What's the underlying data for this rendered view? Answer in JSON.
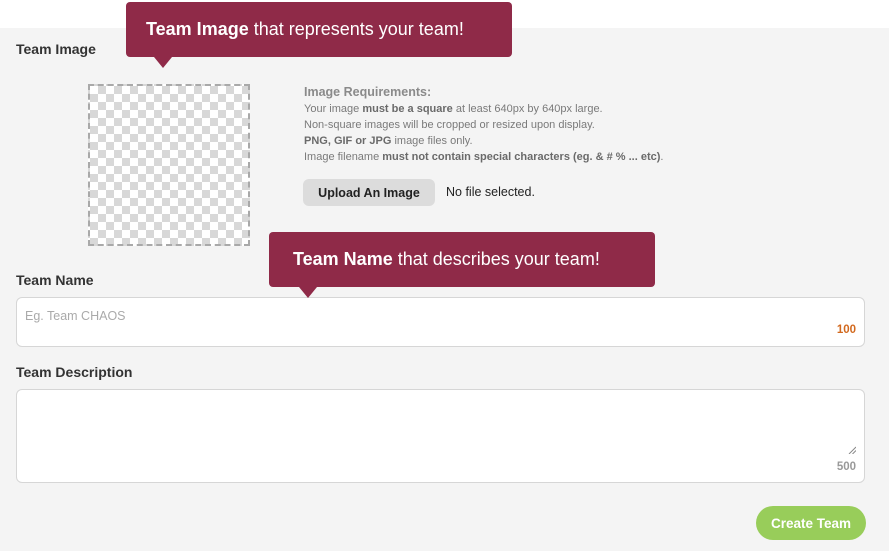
{
  "team_image": {
    "label": "Team Image",
    "preview_icon": "transparent-checkerboard-placeholder",
    "requirements": {
      "title": "Image Requirements:",
      "line1_pre": "Your image ",
      "line1_bold": "must be a square",
      "line1_post": " at least 640px by 640px large.",
      "line2": "Non-square images will be cropped or resized upon display.",
      "line3_bold": "PNG, GIF or JPG",
      "line3_post": " image files only.",
      "line4_pre": "Image filename ",
      "line4_bold": "must not contain special characters (eg. & # % ... etc)",
      "line4_post": "."
    },
    "upload_button_label": "Upload An Image",
    "file_status": "No file selected."
  },
  "tooltips": {
    "image": {
      "bold": "Team Image",
      "rest": " that represents your team!"
    },
    "name": {
      "bold": "Team Name",
      "rest": " that describes your team!"
    }
  },
  "team_name": {
    "label": "Team Name",
    "placeholder": "Eg. Team CHAOS",
    "value": "",
    "char_count": "100"
  },
  "team_description": {
    "label": "Team Description",
    "value": "",
    "char_count": "500"
  },
  "create_button_label": "Create Team",
  "colors": {
    "tooltip_bg": "#8f2a48",
    "create_button_bg": "#98cd5a",
    "name_counter": "#d2691e",
    "description_counter": "#999999"
  }
}
